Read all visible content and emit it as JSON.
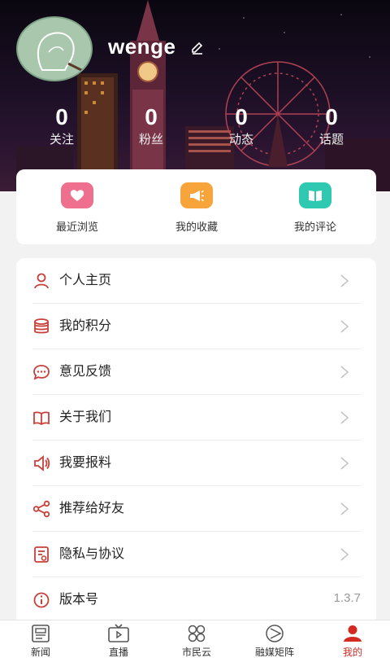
{
  "profile": {
    "username": "wenge"
  },
  "stats": [
    {
      "value": "0",
      "label": "关注"
    },
    {
      "value": "0",
      "label": "粉丝"
    },
    {
      "value": "0",
      "label": "动态"
    },
    {
      "value": "0",
      "label": "话题"
    }
  ],
  "quick_actions": [
    {
      "label": "最近浏览",
      "icon": "heart-icon",
      "color": "#ef6f8e"
    },
    {
      "label": "我的收藏",
      "icon": "megaphone-icon",
      "color": "#f7a53a"
    },
    {
      "label": "我的评论",
      "icon": "book-icon",
      "color": "#2ec9b0"
    }
  ],
  "menu": [
    {
      "label": "个人主页",
      "icon": "user-icon"
    },
    {
      "label": "我的积分",
      "icon": "coins-stack-icon"
    },
    {
      "label": "意见反馈",
      "icon": "chat-bubble-icon"
    },
    {
      "label": "关于我们",
      "icon": "open-book-icon"
    },
    {
      "label": "我要报料",
      "icon": "speaker-icon"
    },
    {
      "label": "推荐给好友",
      "icon": "share-icon"
    },
    {
      "label": "隐私与协议",
      "icon": "document-icon"
    },
    {
      "label": "版本号",
      "icon": "info-icon",
      "value": "1.3.7"
    }
  ],
  "tabbar": [
    {
      "label": "新闻",
      "icon": "newspaper-icon",
      "active": false
    },
    {
      "label": "直播",
      "icon": "tv-icon",
      "active": false
    },
    {
      "label": "市民云",
      "icon": "grid-circles-icon",
      "active": false
    },
    {
      "label": "融媒矩阵",
      "icon": "play-circle-icon",
      "active": false
    },
    {
      "label": "我的",
      "icon": "person-filled-icon",
      "active": true
    }
  ],
  "colors": {
    "accent": "#d32a22",
    "icon_red": "#c8403a"
  }
}
